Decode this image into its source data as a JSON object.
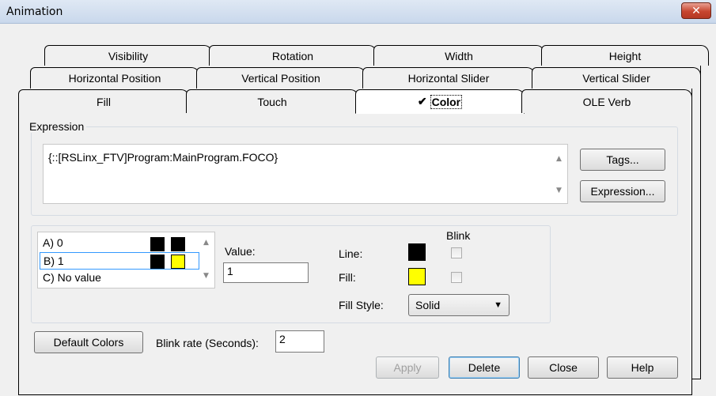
{
  "window": {
    "title": "Animation",
    "close_glyph": "✕"
  },
  "tabs": {
    "row1": [
      {
        "label": "Visibility",
        "mnemonic_index": 0
      },
      {
        "label": "Rotation",
        "mnemonic_index": 0
      },
      {
        "label": "Width",
        "mnemonic_index": 0
      },
      {
        "label": "Height",
        "mnemonic_index": -1
      }
    ],
    "row2": [
      {
        "label": "Horizontal Position"
      },
      {
        "label": "Vertical Position"
      },
      {
        "label": "Horizontal Slider"
      },
      {
        "label": "Vertical Slider"
      }
    ],
    "row3": [
      {
        "label": "Fill"
      },
      {
        "label": "Touch"
      },
      {
        "label": "Color",
        "active": true,
        "check": "✔"
      },
      {
        "label": "OLE Verb"
      }
    ]
  },
  "expression": {
    "group_label": "Expression",
    "value": "{::[RSLinx_FTV]Program:MainProgram.FOCO}",
    "tags_button": "Tags...",
    "expression_button": "Expression..."
  },
  "states": {
    "items": [
      {
        "label": "A) 0",
        "line_color": "#000000",
        "fill_color": "#000000"
      },
      {
        "label": "B) 1",
        "line_color": "#000000",
        "fill_color": "#ffff00",
        "selected": true
      },
      {
        "label": "C) No value"
      }
    ]
  },
  "value_field": {
    "label": "Value:",
    "value": "1"
  },
  "appearance": {
    "blink_label": "Blink",
    "line_label": "Line:",
    "fill_label": "Fill:",
    "line_color": "#000000",
    "fill_color": "#ffff00",
    "fill_style_label": "Fill Style:",
    "fill_style_value": "Solid"
  },
  "bottom": {
    "default_colors": "Default Colors",
    "blink_rate_label": "Blink rate (Seconds):",
    "blink_rate_value": "2",
    "apply": "Apply",
    "delete": "Delete",
    "close": "Close",
    "help": "Help"
  }
}
